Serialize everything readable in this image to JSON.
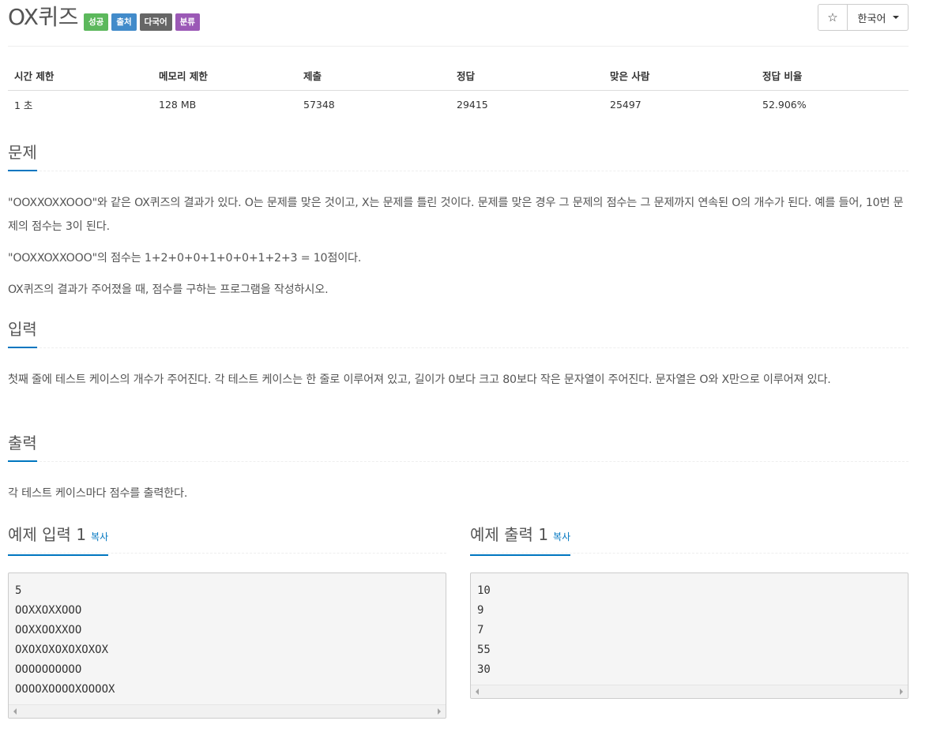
{
  "problem": {
    "title": "OX퀴즈",
    "labels": [
      {
        "text": "성공",
        "color": "#5cb85c"
      },
      {
        "text": "출처",
        "color": "#428bca"
      },
      {
        "text": "다국어",
        "color": "#666666"
      },
      {
        "text": "분류",
        "color": "#9b59b6"
      }
    ]
  },
  "toolbar": {
    "star_icon": "☆",
    "language_label": "한국어"
  },
  "info_table": {
    "headers": [
      "시간 제한",
      "메모리 제한",
      "제출",
      "정답",
      "맞은 사람",
      "정답 비율"
    ],
    "values": [
      "1 초",
      "128 MB",
      "57348",
      "29415",
      "25497",
      "52.906%"
    ]
  },
  "sections": {
    "description": {
      "title": "문제",
      "paragraphs": [
        "\"OOXXOXXOOO\"와 같은 OX퀴즈의 결과가 있다. O는 문제를 맞은 것이고, X는 문제를 틀린 것이다. 문제를 맞은 경우 그 문제의 점수는 그 문제까지 연속된 O의 개수가 된다. 예를 들어, 10번 문제의 점수는 3이 된다.",
        "\"OOXXOXXOOO\"의 점수는 1+2+0+0+1+0+0+1+2+3 = 10점이다.",
        "OX퀴즈의 결과가 주어졌을 때, 점수를 구하는 프로그램을 작성하시오."
      ]
    },
    "input": {
      "title": "입력",
      "paragraphs": [
        "첫째 줄에 테스트 케이스의 개수가 주어진다. 각 테스트 케이스는 한 줄로 이루어져 있고, 길이가 0보다 크고 80보다 작은 문자열이 주어진다. 문자열은 O와 X만으로 이루어져 있다."
      ]
    },
    "output": {
      "title": "출력",
      "paragraphs": [
        "각 테스트 케이스마다 점수를 출력한다."
      ]
    }
  },
  "samples": {
    "input": {
      "title": "예제 입력 1",
      "copy_label": "복사",
      "lines": [
        "5",
        "OOXXOXXOOO",
        "OOXXOOXXOO",
        "OXOXOXOXOXOXOX",
        "OOOOOOOOOO",
        "OOOOXOOOOXOOOOX"
      ]
    },
    "output": {
      "title": "예제 출력 1",
      "copy_label": "복사",
      "lines": [
        "10",
        "9",
        "7",
        "55",
        "30"
      ]
    }
  }
}
